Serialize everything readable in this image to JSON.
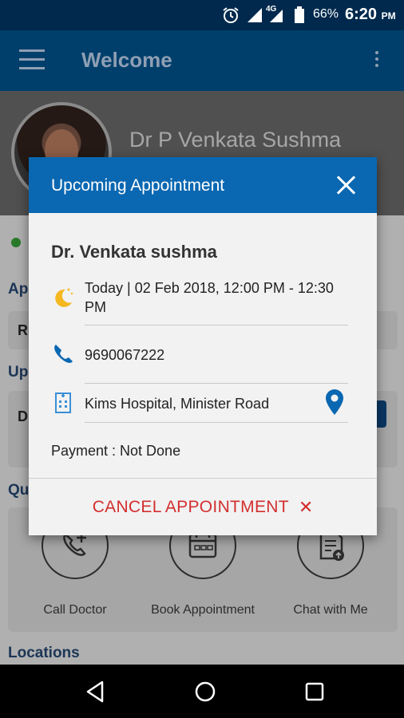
{
  "status_bar": {
    "network": "4G",
    "battery": "66%",
    "time": "6:20",
    "ampm": "PM"
  },
  "app_bar": {
    "title": "Welcome"
  },
  "profile": {
    "doctor_name": "Dr P Venkata Sushma"
  },
  "background": {
    "sections": [
      "App",
      "Up",
      "Qu"
    ],
    "card_initials": [
      "R",
      "D"
    ],
    "quick_actions": [
      {
        "label": "Call Doctor",
        "icon": "phone-plus-icon"
      },
      {
        "label": "Book Appointment",
        "icon": "calendar-icon"
      },
      {
        "label": "Chat with Me",
        "icon": "document-upload-icon"
      }
    ],
    "locations_label": "Locations"
  },
  "dialog": {
    "title": "Upcoming Appointment",
    "doctor": "Dr. Venkata sushma",
    "datetime_line1": "Today | 02 Feb 2018, 12:00 PM - 12:30",
    "datetime_line2": "PM",
    "phone": "9690067222",
    "location": "Kims Hospital, Minister Road",
    "payment": "Payment : Not Done",
    "cancel_label": "CANCEL APPOINTMENT",
    "cancel_glyph": "✕"
  },
  "colors": {
    "header_blue": "#0a67b1",
    "app_bar": "#003f6c",
    "cancel_red": "#d32f2f",
    "pin_blue": "#0a67b1"
  }
}
